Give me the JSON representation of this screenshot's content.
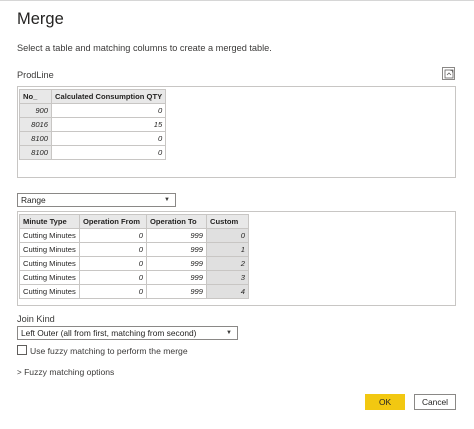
{
  "dialog": {
    "title": "Merge",
    "description": "Select a table and matching columns to create a merged table."
  },
  "first_table": {
    "name": "ProdLine",
    "preview_icon": "preview-icon",
    "headers": [
      "No_",
      "Calculated Consumption QTY"
    ],
    "rows": [
      [
        "900",
        "0"
      ],
      [
        "8016",
        "15"
      ],
      [
        "8100",
        "0"
      ],
      [
        "8100",
        "0"
      ]
    ]
  },
  "second_table": {
    "selected": "Range",
    "headers": [
      "Minute Type",
      "Operation From",
      "Operation To",
      "Custom"
    ],
    "rows": [
      [
        "Cutting Minutes",
        "0",
        "999",
        "0"
      ],
      [
        "Cutting Minutes",
        "0",
        "999",
        "1"
      ],
      [
        "Cutting Minutes",
        "0",
        "999",
        "2"
      ],
      [
        "Cutting Minutes",
        "0",
        "999",
        "3"
      ],
      [
        "Cutting Minutes",
        "0",
        "999",
        "4"
      ]
    ]
  },
  "join": {
    "label": "Join Kind",
    "selected": "Left Outer (all from first, matching from second)"
  },
  "fuzzy": {
    "checkbox_label": "Use fuzzy matching to perform the merge",
    "checked": false,
    "options_label": "Fuzzy matching options"
  },
  "buttons": {
    "ok": "OK",
    "cancel": "Cancel"
  },
  "colors": {
    "ok_button": "#F2C811",
    "header_bg": "#E8E8E8"
  }
}
